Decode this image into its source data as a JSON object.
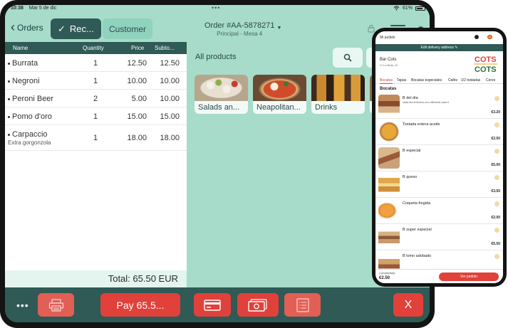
{
  "status": {
    "time": "10:38",
    "date": "Mar 5 de dic",
    "dots": "•••",
    "battery": "61%"
  },
  "topbar": {
    "back_label": "Orders",
    "tab_receipt": "Rec...",
    "tab_customer": "Customer",
    "order_title": "Order #AA-5878271",
    "order_subtitle": "Principal - Mesa 4"
  },
  "table": {
    "headers": {
      "name": "Name",
      "qty": "Quantity",
      "price": "Price",
      "subtotal": "Subto..."
    },
    "rows": [
      {
        "name": "Burrata",
        "qty": "1",
        "price": "12.50",
        "subtotal": "12.50"
      },
      {
        "name": "Negroni",
        "qty": "1",
        "price": "10.00",
        "subtotal": "10.00"
      },
      {
        "name": "Peroni Beer",
        "qty": "2",
        "price": "5.00",
        "subtotal": "10.00"
      },
      {
        "name": "Pomo d'oro",
        "qty": "1",
        "price": "15.00",
        "subtotal": "15.00"
      },
      {
        "name": "Carpaccio",
        "note": "Extra gorgonzola",
        "qty": "1",
        "price": "18.00",
        "subtotal": "18.00"
      }
    ],
    "total": "Total: 65.50 EUR"
  },
  "products": {
    "heading": "All products",
    "categories": [
      "Salads an...",
      "Neapolitan...",
      "Drinks"
    ]
  },
  "bottombar": {
    "more": "•••",
    "pay_label": "Pay 65.5...",
    "close_label": "X"
  },
  "phone": {
    "header_label": "Mi pedido",
    "delivery": "Edit delivery address",
    "bar_name": "Bar Cots",
    "bar_address": "C/ La Bola, 12",
    "logo_line1": "COTS",
    "logo_line2": "COTS",
    "categories": [
      "Bocatas",
      "Tapas",
      "Bocatas especiales",
      "Cafés",
      "1/2 tostadas",
      "Cerve"
    ],
    "section": "Bocatas",
    "items": [
      {
        "name": "B del día",
        "desc": "cada día tenemos uno diferente para ti",
        "price": "€3.20"
      },
      {
        "name": "Tostada entera aceite",
        "desc": "",
        "price": "€2.50"
      },
      {
        "name": "B especial",
        "desc": "",
        "price": "€5.00"
      },
      {
        "name": "B queso",
        "desc": "",
        "price": "€3.50"
      },
      {
        "name": "Coqueta fregida",
        "desc": "",
        "price": "€2.00"
      },
      {
        "name": "B super especial",
        "desc": "",
        "price": "€5.50"
      },
      {
        "name": "B lomo adobado",
        "desc": "",
        "price": ""
      }
    ],
    "footer_count": "1 producto(s)",
    "footer_total": "€2.50",
    "footer_button": "Ver pedido"
  }
}
